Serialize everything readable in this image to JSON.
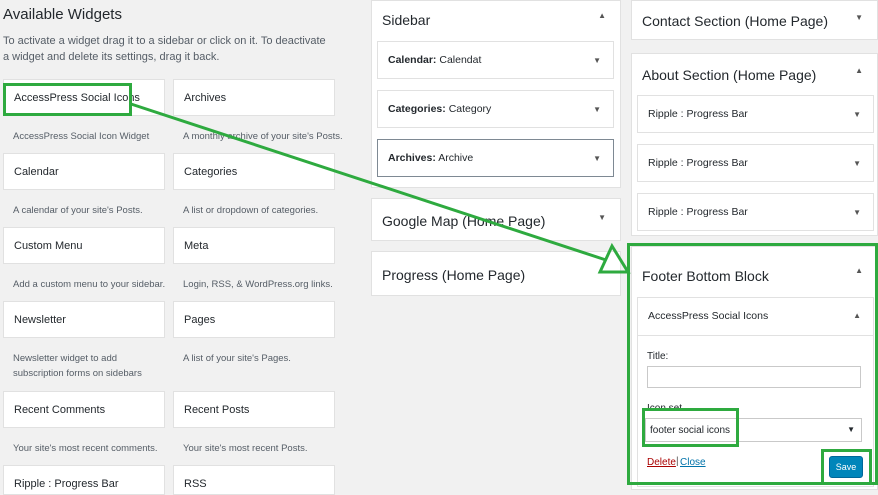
{
  "available_widgets": {
    "title": "Available Widgets",
    "description": "To activate a widget drag it to a sidebar or click on it. To deactivate a widget and delete its settings, drag it back.",
    "widgets": [
      {
        "name": "AccessPress Social Icons",
        "description": "AccessPress Social Icon Widget"
      },
      {
        "name": "Archives",
        "description": "A monthly archive of your site's Posts."
      },
      {
        "name": "Calendar",
        "description": "A calendar of your site's Posts."
      },
      {
        "name": "Categories",
        "description": "A list or dropdown of categories."
      },
      {
        "name": "Custom Menu",
        "description": "Add a custom menu to your sidebar."
      },
      {
        "name": "Meta",
        "description": "Login, RSS, & WordPress.org links."
      },
      {
        "name": "Newsletter",
        "description": "Newsletter widget to add subscription forms on sidebars"
      },
      {
        "name": "Pages",
        "description": "A list of your site's Pages."
      },
      {
        "name": "Recent Comments",
        "description": "Your site's most recent comments."
      },
      {
        "name": "Recent Posts",
        "description": "Your site's most recent Posts."
      },
      {
        "name": "Ripple : Progress Bar",
        "description": ""
      },
      {
        "name": "RSS",
        "description": ""
      }
    ]
  },
  "sidebar": {
    "title": "Sidebar",
    "items": [
      {
        "type": "Calendar:",
        "name": "Calendat"
      },
      {
        "type": "Categories:",
        "name": "Category"
      },
      {
        "type": "Archives:",
        "name": "Archive"
      }
    ]
  },
  "google_map": {
    "title": "Google Map (Home Page)"
  },
  "progress": {
    "title": "Progress (Home Page)"
  },
  "contact_section": {
    "title": "Contact Section (Home Page)"
  },
  "about_section": {
    "title": "About Section (Home Page)",
    "items": [
      {
        "name": "Ripple : Progress Bar"
      },
      {
        "name": "Ripple : Progress Bar"
      },
      {
        "name": "Ripple : Progress Bar"
      }
    ]
  },
  "footer_bottom": {
    "title": "Footer Bottom Block",
    "widget": {
      "title": "AccessPress Social Icons",
      "title_label": "Title:",
      "title_value": "",
      "icon_set_label": "Icon set",
      "icon_set_value": "footer social icons",
      "delete_label": "Delete",
      "separator": "|",
      "close_label": "Close",
      "save_label": "Save"
    }
  },
  "glyphs": {
    "caret_down": "▼",
    "caret_up": "▲"
  },
  "colors": {
    "highlight": "#2eaa3f",
    "save_button": "#0085ba",
    "delete_link": "#a00",
    "close_link": "#0073aa"
  }
}
